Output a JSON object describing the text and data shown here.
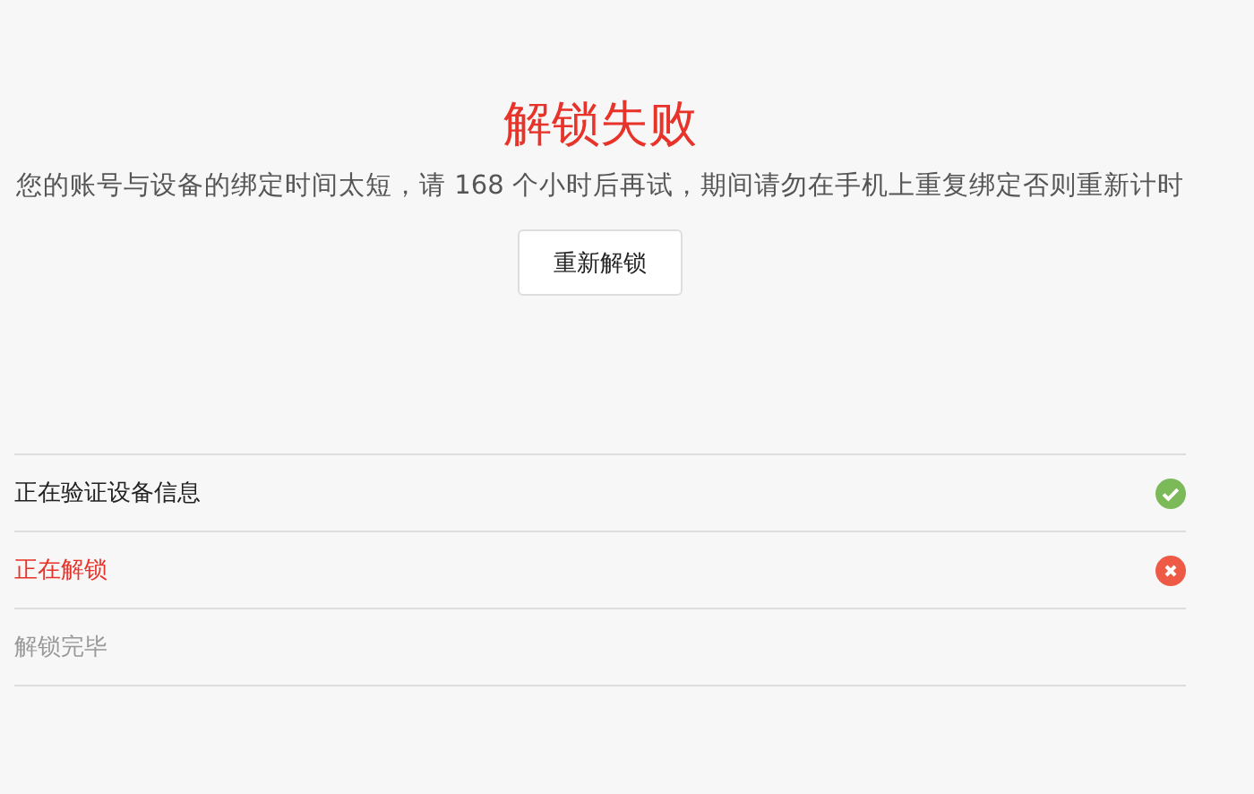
{
  "result": {
    "title": "解锁失败",
    "message": "您的账号与设备的绑定时间太短，请 168 个小时后再试，期间请勿在手机上重复绑定否则重新计时",
    "button": "重新解锁"
  },
  "steps": [
    {
      "label": "正在验证设备信息",
      "kind": "done"
    },
    {
      "label": "正在解锁",
      "kind": "failed"
    },
    {
      "label": "解锁完毕",
      "kind": "pending"
    }
  ]
}
